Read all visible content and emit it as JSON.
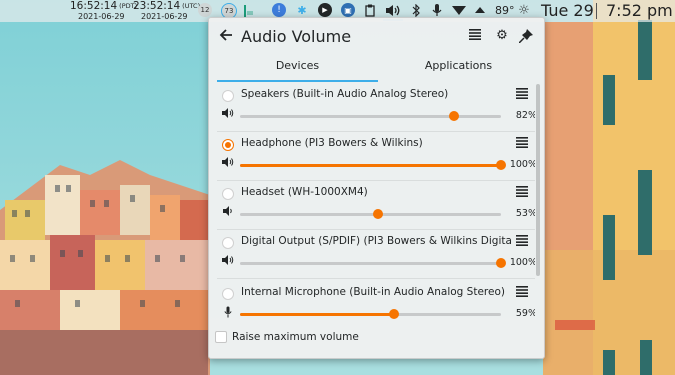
{
  "panel": {
    "clock_local": {
      "time": "16:52:14",
      "tz": "(PDT)",
      "date": "2021-06-29"
    },
    "clock_utc": {
      "time": "23:52:14",
      "tz": "(UTC)",
      "date": "2021-06-29"
    },
    "badges": [
      "12",
      "73"
    ],
    "temperature": "89°",
    "day": "Tue 29",
    "time": "7:52 pm"
  },
  "popup": {
    "title": "Audio Volume",
    "tabs": [
      "Devices",
      "Applications"
    ],
    "active_tab": "Devices",
    "devices": [
      {
        "name": "Speakers (Built-in Audio Analog Stereo)",
        "volume": "82%",
        "level": 0.82,
        "selected": false,
        "fill_visible": false,
        "icon": "speaker-icon"
      },
      {
        "name": "Headphone (PI3 Bowers & Wilkins)",
        "volume": "100%",
        "level": 1.0,
        "selected": true,
        "fill_visible": true,
        "icon": "speaker-icon"
      },
      {
        "name": "Headset (WH-1000XM4)",
        "volume": "53%",
        "level": 0.53,
        "selected": false,
        "fill_visible": false,
        "icon": "speaker-low-icon"
      },
      {
        "name": "Digital Output (S/PDIF) (PI3 Bowers & Wilkins Digital ...",
        "volume": "100%",
        "level": 1.0,
        "selected": false,
        "fill_visible": false,
        "icon": "speaker-icon"
      },
      {
        "name": "Internal Microphone (Built-in Audio Analog Stereo)",
        "volume": "59%",
        "level": 0.59,
        "selected": false,
        "fill_visible": true,
        "icon": "microphone-icon"
      }
    ],
    "raise_max_label": "Raise maximum volume"
  },
  "colors": {
    "accent": "#f67400",
    "tab_active": "#3daee9"
  }
}
